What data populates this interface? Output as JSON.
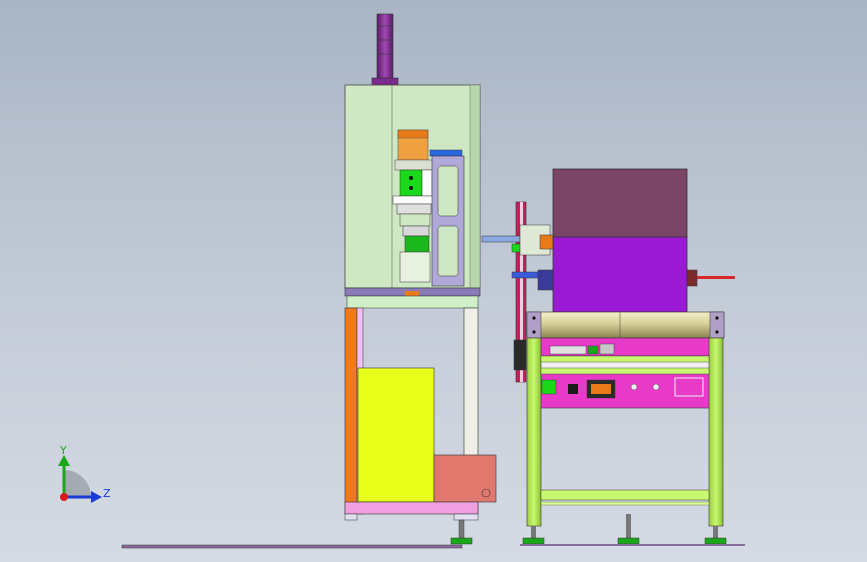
{
  "viewport": {
    "background_top": "#a9b5c4",
    "background_bottom": "#d5dbe4"
  },
  "triad": {
    "y_label": "Y",
    "z_label": "Z",
    "y_color": "#1aa81a",
    "z_color": "#1a3ad8",
    "x_color": "#d81a1a"
  },
  "colors": {
    "cabinet_panel": "#cfe8c4",
    "frame_green": "#b6f05a",
    "panel_magenta": "#e83ac8",
    "box_purple": "#9a1ad4",
    "box_maroon": "#7a4466",
    "roller": "#d8d09a",
    "yellow_block": "#e8ff1a",
    "salmon_block": "#e0786e",
    "orange_post": "#f07a1a",
    "pink_base": "#f0a0e0",
    "stack_light": "#8a3a9a"
  }
}
